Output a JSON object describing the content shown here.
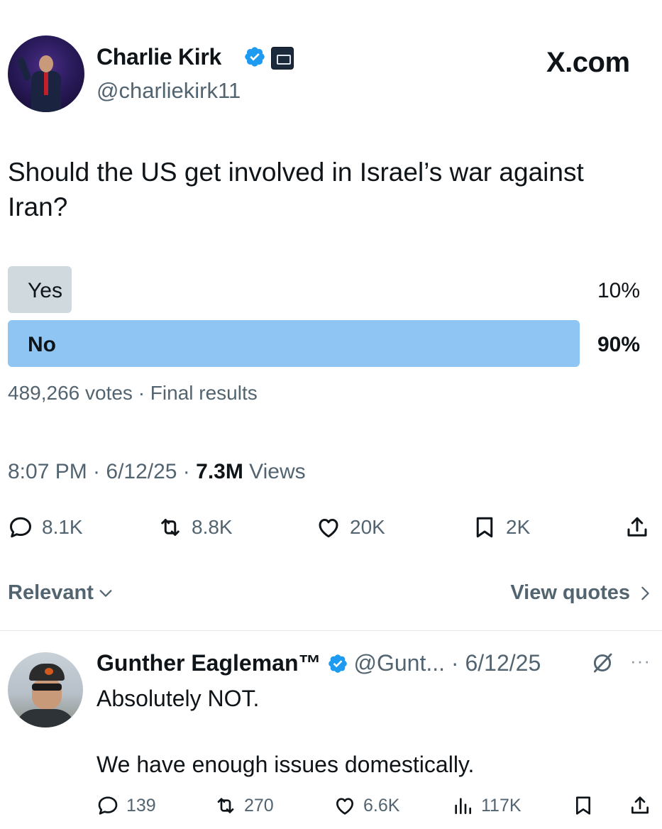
{
  "tweet": {
    "author_name": "Charlie Kirk",
    "author_handle": "@charliekirk11",
    "site_label": "X.com",
    "text": "Should the US get involved in Israel’s war against Iran?",
    "poll": {
      "options": [
        {
          "label": "Yes",
          "percent_label": "10%",
          "share": 0.1,
          "winner": false
        },
        {
          "label": "No",
          "percent_label": "90%",
          "share": 0.9,
          "winner": true
        }
      ],
      "votes_text": "489,266 votes · Final results"
    },
    "time": "8:07 PM · 6/12/25 · ",
    "views_count": "7.3M",
    "views_label": " Views",
    "actions": {
      "replies": "8.1K",
      "reposts": "8.8K",
      "likes": "20K",
      "bookmarks": "2K"
    },
    "sort_label": "Relevant",
    "view_quotes_label": "View quotes"
  },
  "reply": {
    "author_name": "Gunther Eagleman™",
    "meta": "@Gunt... · 6/12/25",
    "more": "···",
    "line1": "Absolutely NOT.",
    "line2": "We have enough issues domestically.",
    "actions": {
      "replies": "139",
      "reposts": "270",
      "likes": "6.6K",
      "views": "117K"
    }
  },
  "colors": {
    "verified_blue": "#1d9bf0",
    "poll_winner": "#8ec5f3",
    "poll_loser": "#cfd9de",
    "muted_text": "#536471"
  },
  "icons": [
    "verified-badge-icon",
    "affiliate-badge-icon",
    "reply-icon",
    "repost-icon",
    "like-icon",
    "bookmark-icon",
    "share-icon",
    "views-icon",
    "chevron-down-icon",
    "chevron-right-icon",
    "grok-icon"
  ]
}
